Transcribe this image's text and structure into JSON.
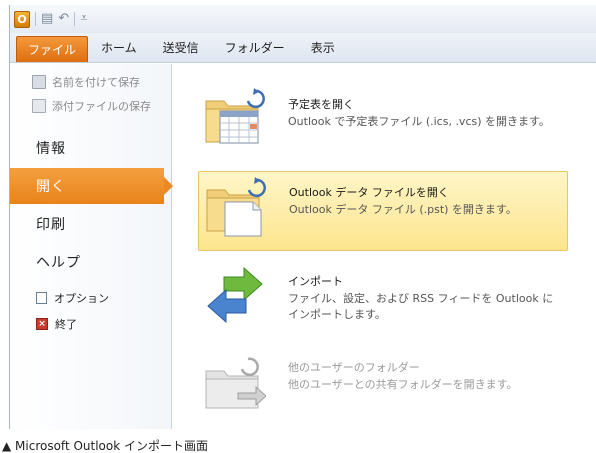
{
  "window": {
    "app_badge": "O",
    "qat_items": [
      {
        "icon": "new-item-icon",
        "glyph": "▤"
      },
      {
        "icon": "undo-icon",
        "glyph": "↶"
      },
      {
        "icon": "customize-qat-icon",
        "glyph": "⩡"
      }
    ]
  },
  "ribbon": {
    "tabs": [
      "ファイル",
      "ホーム",
      "送受信",
      "フォルダー",
      "表示"
    ],
    "active_tab": "ファイル",
    "accent_color": "#e8831a"
  },
  "backstage": {
    "commands": [
      {
        "label": "名前を付けて保存",
        "enabled": false
      },
      {
        "label": "添付ファイルの保存",
        "enabled": false
      }
    ],
    "nav": [
      "情報",
      "開く",
      "印刷",
      "ヘルプ"
    ],
    "active_nav": "開く",
    "small_commands": [
      "オプション",
      "終了"
    ]
  },
  "open_options": [
    {
      "title": "予定表を開く",
      "description": "Outlook で予定表ファイル (.ics, .vcs) を開きます。",
      "icon": "open-calendar-icon",
      "highlighted": false,
      "enabled": true
    },
    {
      "title": "Outlook データ ファイルを開く",
      "description": "Outlook データ ファイル (.pst) を開きます。",
      "icon": "open-data-file-icon",
      "highlighted": true,
      "enabled": true
    },
    {
      "title": "インポート",
      "description": "ファイル、設定、および RSS フィードを Outlook にインポートします。",
      "icon": "import-icon",
      "highlighted": false,
      "enabled": true
    },
    {
      "title": "他のユーザーのフォルダー",
      "description": "他のユーザーとの共有フォルダーを開きます。",
      "icon": "shared-folder-icon",
      "highlighted": false,
      "enabled": false
    }
  ],
  "caption": "▲ Microsoft Outlook インポート画面"
}
